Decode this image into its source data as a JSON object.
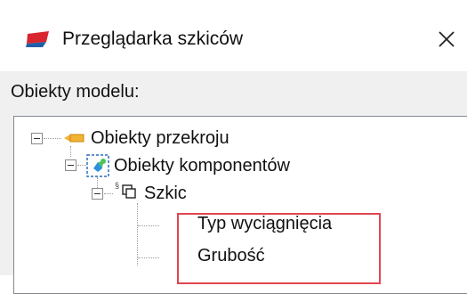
{
  "window": {
    "title": "Przeglądarka szkiców",
    "close_glyph": "✕"
  },
  "panel": {
    "label": "Obiekty modelu:"
  },
  "tree": {
    "items": [
      {
        "label": "Obiekty przekroju",
        "icon": "section-objects-icon",
        "expanded": true
      },
      {
        "label": "Obiekty komponentów",
        "icon": "component-objects-icon",
        "expanded": true
      },
      {
        "label": "Szkic",
        "icon": "sketch-icon",
        "expanded": true
      },
      {
        "label": "Typ wyciągnięcia",
        "icon": "none"
      },
      {
        "label": "Grubość",
        "icon": "none"
      }
    ]
  },
  "colors": {
    "highlight": "#e2454f",
    "app_icon_red": "#d9252e",
    "app_icon_blue": "#1f5fa8",
    "section_icon_orange": "#f2b233"
  }
}
